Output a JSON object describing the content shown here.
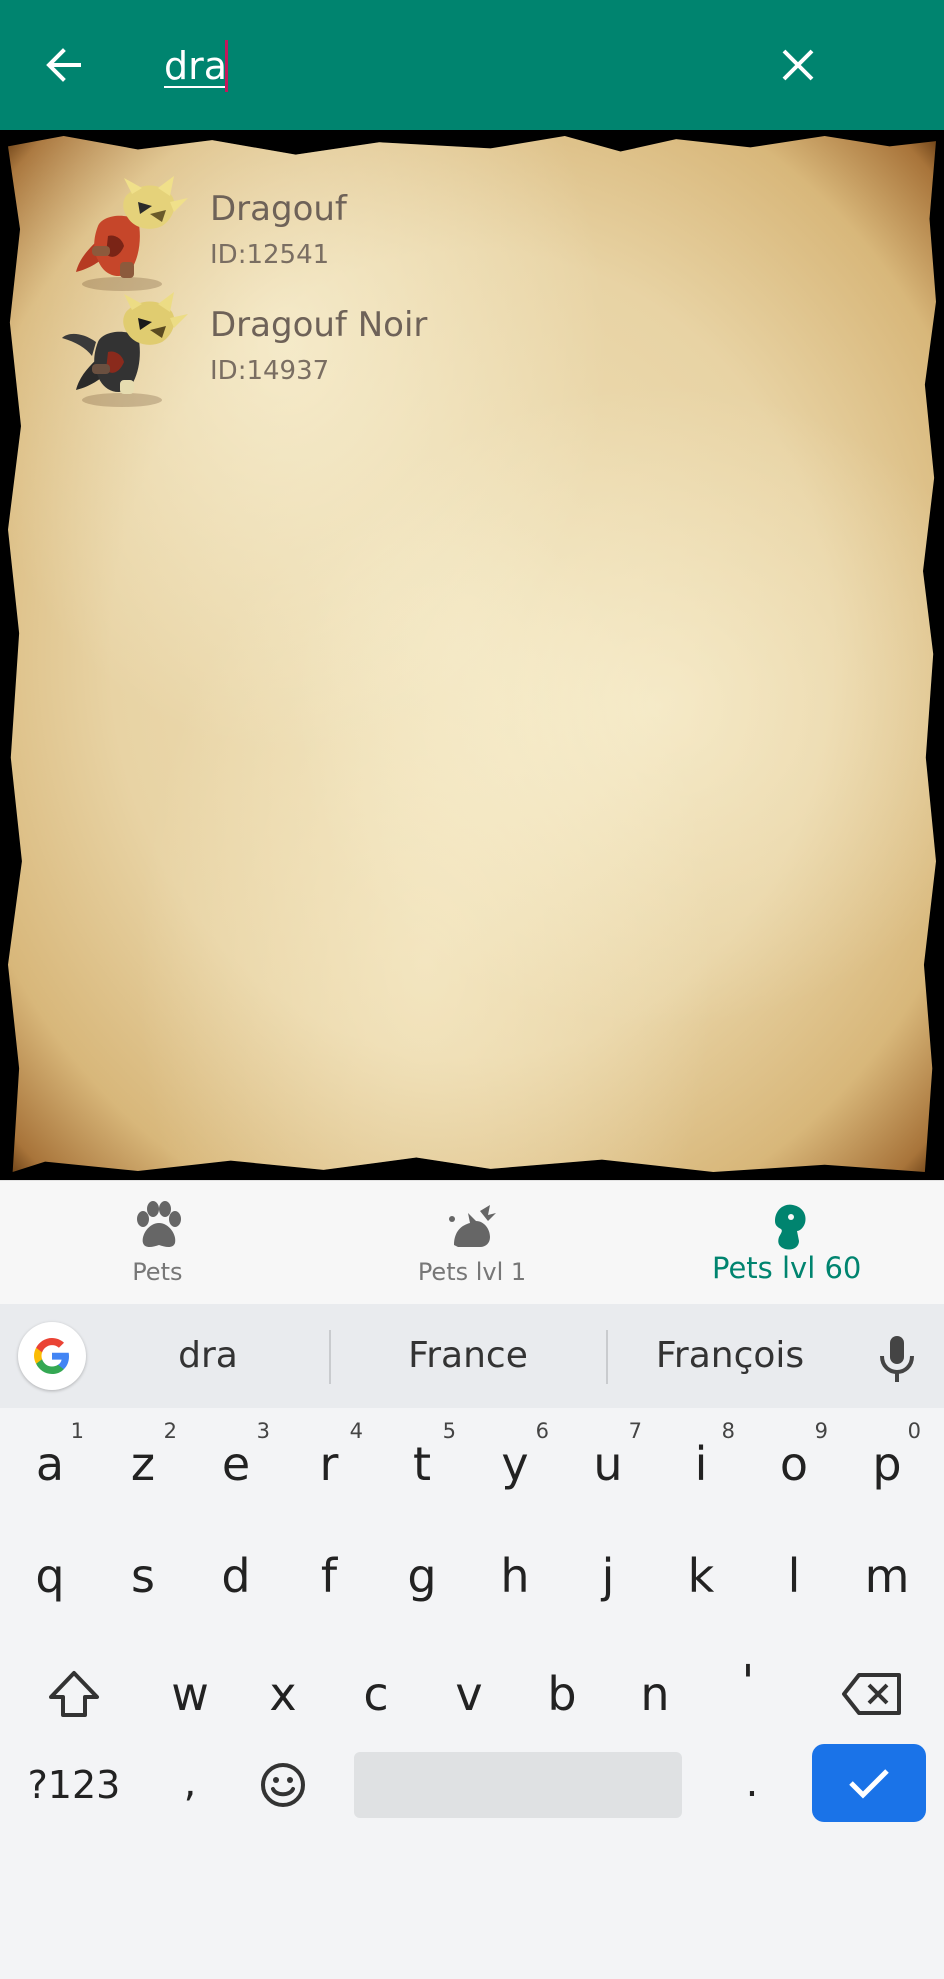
{
  "search": {
    "query": "dra",
    "back_icon": "arrow-back-icon",
    "clear_icon": "close-icon"
  },
  "results": [
    {
      "name": "Dragouf",
      "id": "ID:12541",
      "icon": "red-dragon-pet-icon"
    },
    {
      "name": "Dragouf Noir",
      "id": "ID:14937",
      "icon": "black-dragon-pet-icon"
    }
  ],
  "bottom_nav": {
    "tabs": [
      {
        "label": "Pets",
        "icon": "paw-icon",
        "active": false
      },
      {
        "label": "Pets lvl 1",
        "icon": "baby-pet-icon",
        "active": false
      },
      {
        "label": "Pets lvl 60",
        "icon": "adult-pet-icon",
        "active": true
      }
    ]
  },
  "keyboard": {
    "suggestions": [
      "dra",
      "France",
      "François"
    ],
    "row1": [
      {
        "key": "a",
        "hint": "1"
      },
      {
        "key": "z",
        "hint": "2"
      },
      {
        "key": "e",
        "hint": "3"
      },
      {
        "key": "r",
        "hint": "4"
      },
      {
        "key": "t",
        "hint": "5"
      },
      {
        "key": "y",
        "hint": "6"
      },
      {
        "key": "u",
        "hint": "7"
      },
      {
        "key": "i",
        "hint": "8"
      },
      {
        "key": "o",
        "hint": "9"
      },
      {
        "key": "p",
        "hint": "0"
      }
    ],
    "row2": [
      "q",
      "s",
      "d",
      "f",
      "g",
      "h",
      "j",
      "k",
      "l",
      "m"
    ],
    "row3": [
      "w",
      "x",
      "c",
      "v",
      "b",
      "n",
      "'"
    ],
    "symbols_label": "?123",
    "comma": ",",
    "period": ".",
    "colors": {
      "enter": "#1a73e8",
      "toolbar": "#00846f"
    }
  }
}
